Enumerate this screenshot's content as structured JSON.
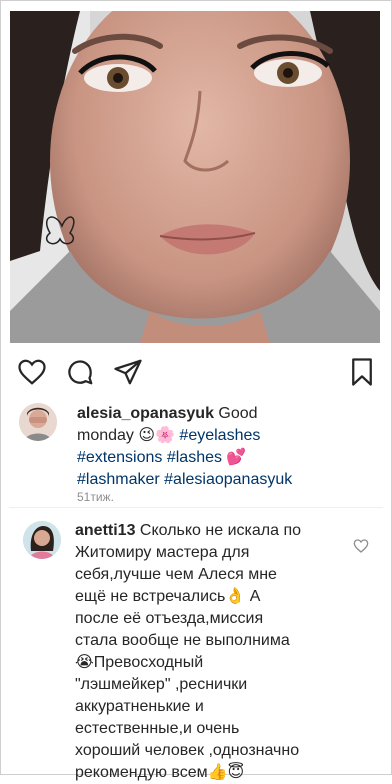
{
  "post": {
    "photo_icon": "portrait-photo",
    "actions": {
      "like_icon": "heart-icon",
      "comment_icon": "comment-bubble-icon",
      "share_icon": "paper-plane-icon",
      "save_icon": "bookmark-icon"
    }
  },
  "caption": {
    "username": "alesia_opanasyuk",
    "lines": [
      {
        "plain": " Good"
      },
      {
        "plain": "monday 😉🌸 ",
        "tag": "#eyelashes"
      },
      {
        "tag": "#extensions #lashes",
        "plain": " 💕"
      },
      {
        "tag": "#lashmaker #alesiaopanasyuk"
      }
    ],
    "time": "51тиж."
  },
  "comment": {
    "username": "anetti13",
    "lines": [
      " Сколько не искала по",
      "Житомиру мастера для",
      "себя,лучше чем Алеся мне",
      "ещё не встречались👌 А",
      "после её отъезда,миссия",
      "стала вообще не выполнима",
      "😭Превосходный",
      "\"лэшмейкер\" ,реснички",
      "аккуратненькие и",
      "естественные,и очень",
      "хороший человек ,однозначно",
      "рекомендую всем👍😇"
    ],
    "like_icon": "heart-outline-icon"
  }
}
